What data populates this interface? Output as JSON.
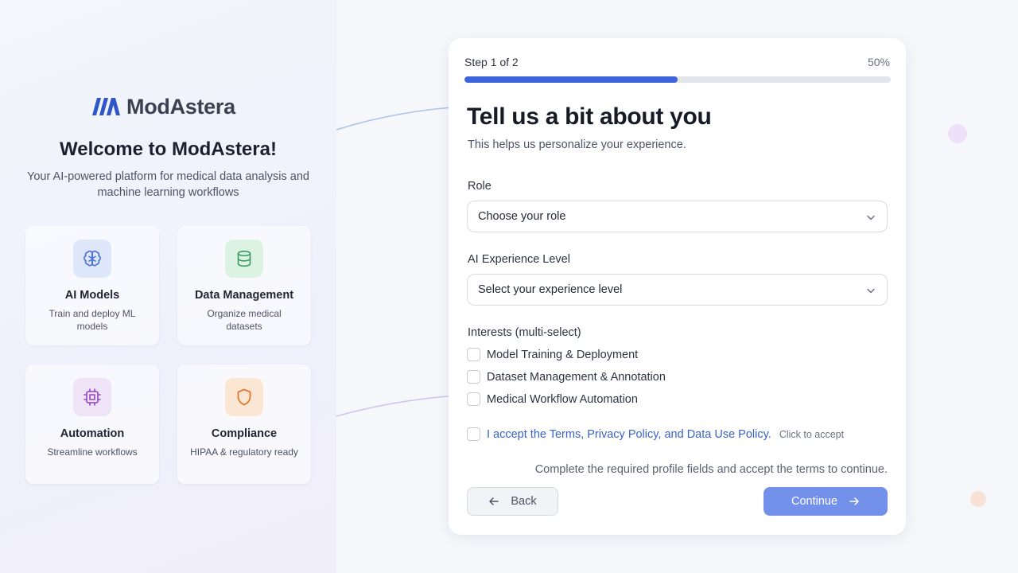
{
  "brand": {
    "name": "ModAstera",
    "accent": "#2f56c9"
  },
  "welcome": {
    "title": "Welcome to ModAstera!",
    "tagline": "Your AI-powered platform for medical data analysis and machine learning workflows"
  },
  "features": [
    {
      "title": "AI Models",
      "desc": "Train and deploy ML models",
      "icon": "brain-icon",
      "bg": "#dfe8fb",
      "color": "#4a6fd8"
    },
    {
      "title": "Data Management",
      "desc": "Organize medical datasets",
      "icon": "database-icon",
      "bg": "#dcf3e3",
      "color": "#3a9a5e"
    },
    {
      "title": "Automation",
      "desc": "Streamline workflows",
      "icon": "cpu-icon",
      "bg": "#efe3f8",
      "color": "#9446c4"
    },
    {
      "title": "Compliance",
      "desc": "HIPAA & regulatory ready",
      "icon": "shield-icon",
      "bg": "#fbe6d3",
      "color": "#e27a2e"
    }
  ],
  "progress": {
    "step_text": "Step 1 of 2",
    "percent_text": "50%",
    "value": 0.5,
    "color": "#3d63dd"
  },
  "form": {
    "title": "Tell us a bit about you",
    "subtitle": "This helps us personalize your experience.",
    "role": {
      "label": "Role",
      "value": "Choose your role"
    },
    "experience": {
      "label": "AI Experience Level",
      "value": "Select your experience level"
    },
    "interests": {
      "label": "Interests (multi-select)",
      "options": [
        "Model Training & Deployment",
        "Dataset Management & Annotation",
        "Medical Workflow Automation"
      ]
    },
    "terms": {
      "text": "I accept the Terms, Privacy Policy, and Data Use Policy.",
      "hint": "Click to accept"
    },
    "notice": "Complete the required profile fields and accept the terms to continue.",
    "back_label": "Back",
    "continue_label": "Continue"
  }
}
